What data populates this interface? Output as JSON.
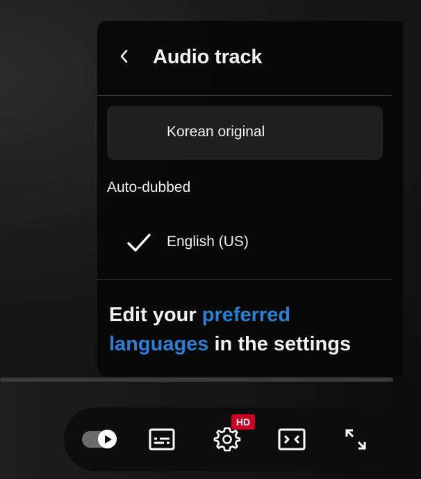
{
  "menu": {
    "title": "Audio track",
    "options": [
      {
        "label": "Korean original",
        "selected": false
      },
      {
        "label": "English (US)",
        "selected": true
      }
    ],
    "section_label": "Auto-dubbed",
    "settings_note": {
      "prefix": "Edit your ",
      "link_text_1": "preferred",
      "link_text_2": "languages",
      "suffix": " in the settings"
    }
  },
  "controls": {
    "autoplay_icon": "autoplay-toggle-icon",
    "captions_icon": "subtitles-icon",
    "settings_icon": "gear-icon",
    "quality_badge": "HD",
    "theater_icon": "theater-mode-icon",
    "fullscreen_icon": "fullscreen-icon"
  },
  "colors": {
    "menu_bg": "#080808",
    "link": "#2b7fd4",
    "hd_badge": "#cc0022",
    "selected_option_bg": "#1f1f1f"
  }
}
